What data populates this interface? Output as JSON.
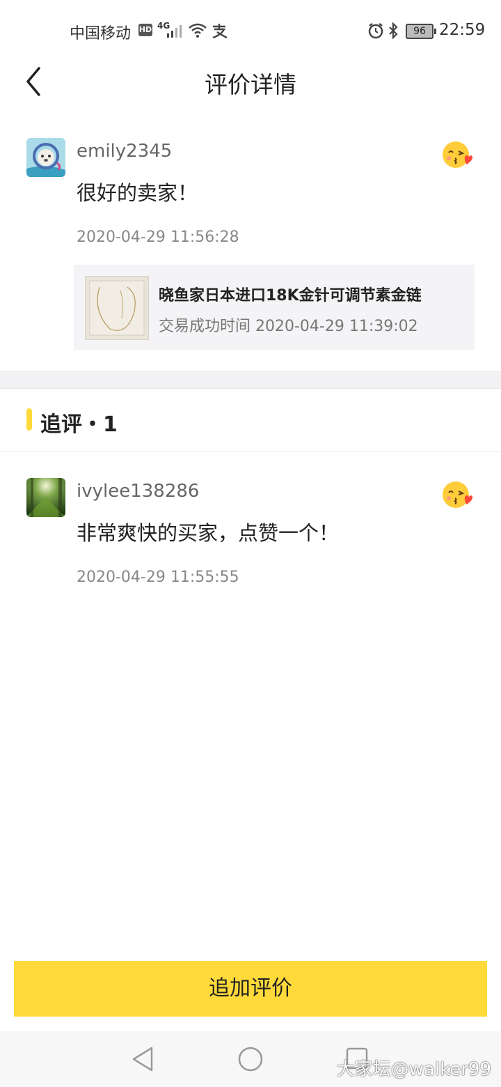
{
  "status_bar": {
    "carrier": "中国移动",
    "hd": "HD",
    "network": "4G",
    "battery": "96",
    "time": "22:59"
  },
  "header": {
    "title": "评价详情"
  },
  "review": {
    "username": "emily2345",
    "content": "很好的卖家！",
    "time": "2020-04-29 11:56:28",
    "product": {
      "title": "晓鱼家日本进口18K金针可调节素金链",
      "trade_time": "交易成功时间 2020-04-29 11:39:02"
    }
  },
  "follow_up": {
    "title": "追评・1",
    "items": [
      {
        "username": "ivylee138286",
        "content": "非常爽快的买家，点赞一个！",
        "time": "2020-04-29 11:55:55"
      }
    ]
  },
  "bottom_button": {
    "label": "追加评价"
  },
  "watermark": "大家坛@walker99",
  "colors": {
    "accent": "#ffda3a",
    "card_bg": "#f4f4f7"
  }
}
